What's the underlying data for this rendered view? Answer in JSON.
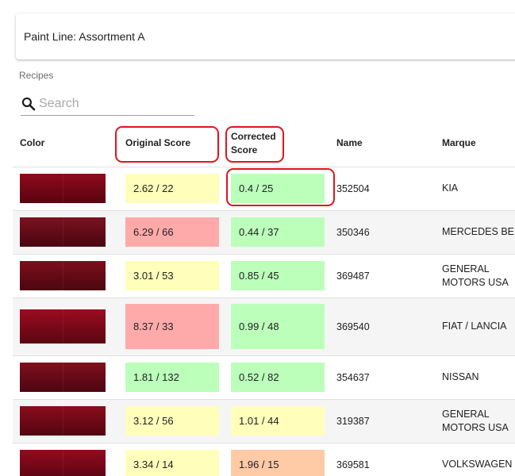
{
  "header": {
    "title": "Paint Line: Assortment A"
  },
  "recipes_label": "Recipes",
  "search": {
    "placeholder": "Search",
    "icon": "search-icon"
  },
  "columns": {
    "color": "Color",
    "original_score": "Original Score",
    "corrected_score_line1": "Corrected",
    "corrected_score_line2": "Score",
    "name": "Name",
    "marque": "Marque"
  },
  "status_colors": {
    "good": "#bbffbb",
    "warn": "#ffffbb",
    "bad": "#ffaaaa",
    "medium": "#ffcaa6",
    "highlight": "#e0151f"
  },
  "rows": [
    {
      "original": "2.62 / 22",
      "original_status": "warn",
      "corrected": "0.4 / 25",
      "corrected_status": "good",
      "name": "352504",
      "marque": "KIA",
      "swatch": [
        "#8e0b1b",
        "#5a0310"
      ]
    },
    {
      "original": "6.29 / 66",
      "original_status": "bad",
      "corrected": "0.44 / 37",
      "corrected_status": "good",
      "name": "350346",
      "marque": "MERCEDES BENZ",
      "swatch": [
        "#7a1220",
        "#4a0510"
      ]
    },
    {
      "original": "3.01 / 53",
      "original_status": "warn",
      "corrected": "0.85 / 45",
      "corrected_status": "good",
      "name": "369487",
      "marque": "GENERAL MOTORS USA",
      "swatch": [
        "#7e0e1c",
        "#4b0710"
      ]
    },
    {
      "original": "8.37 / 33",
      "original_status": "bad",
      "corrected": "0.99 / 48",
      "corrected_status": "good",
      "name": "369540",
      "marque": "FIAT / LANCIA",
      "swatch": [
        "#9a0c1f",
        "#5b0612"
      ]
    },
    {
      "original": "1.81 / 132",
      "original_status": "good",
      "corrected": "0.52 / 82",
      "corrected_status": "good",
      "name": "354637",
      "marque": "NISSAN",
      "swatch": [
        "#80101d",
        "#4c0611"
      ]
    },
    {
      "original": "3.12 / 56",
      "original_status": "warn",
      "corrected": "1.01 / 44",
      "corrected_status": "warn",
      "name": "319387",
      "marque": "GENERAL MOTORS USA",
      "swatch": [
        "#8a0d1c",
        "#530510"
      ]
    },
    {
      "original": "3.34 / 14",
      "original_status": "warn",
      "corrected": "1.96 / 15",
      "corrected_status": "medium",
      "name": "369581",
      "marque": "VOLKSWAGEN",
      "swatch": [
        "#930b1d",
        "#5a0412"
      ]
    }
  ]
}
